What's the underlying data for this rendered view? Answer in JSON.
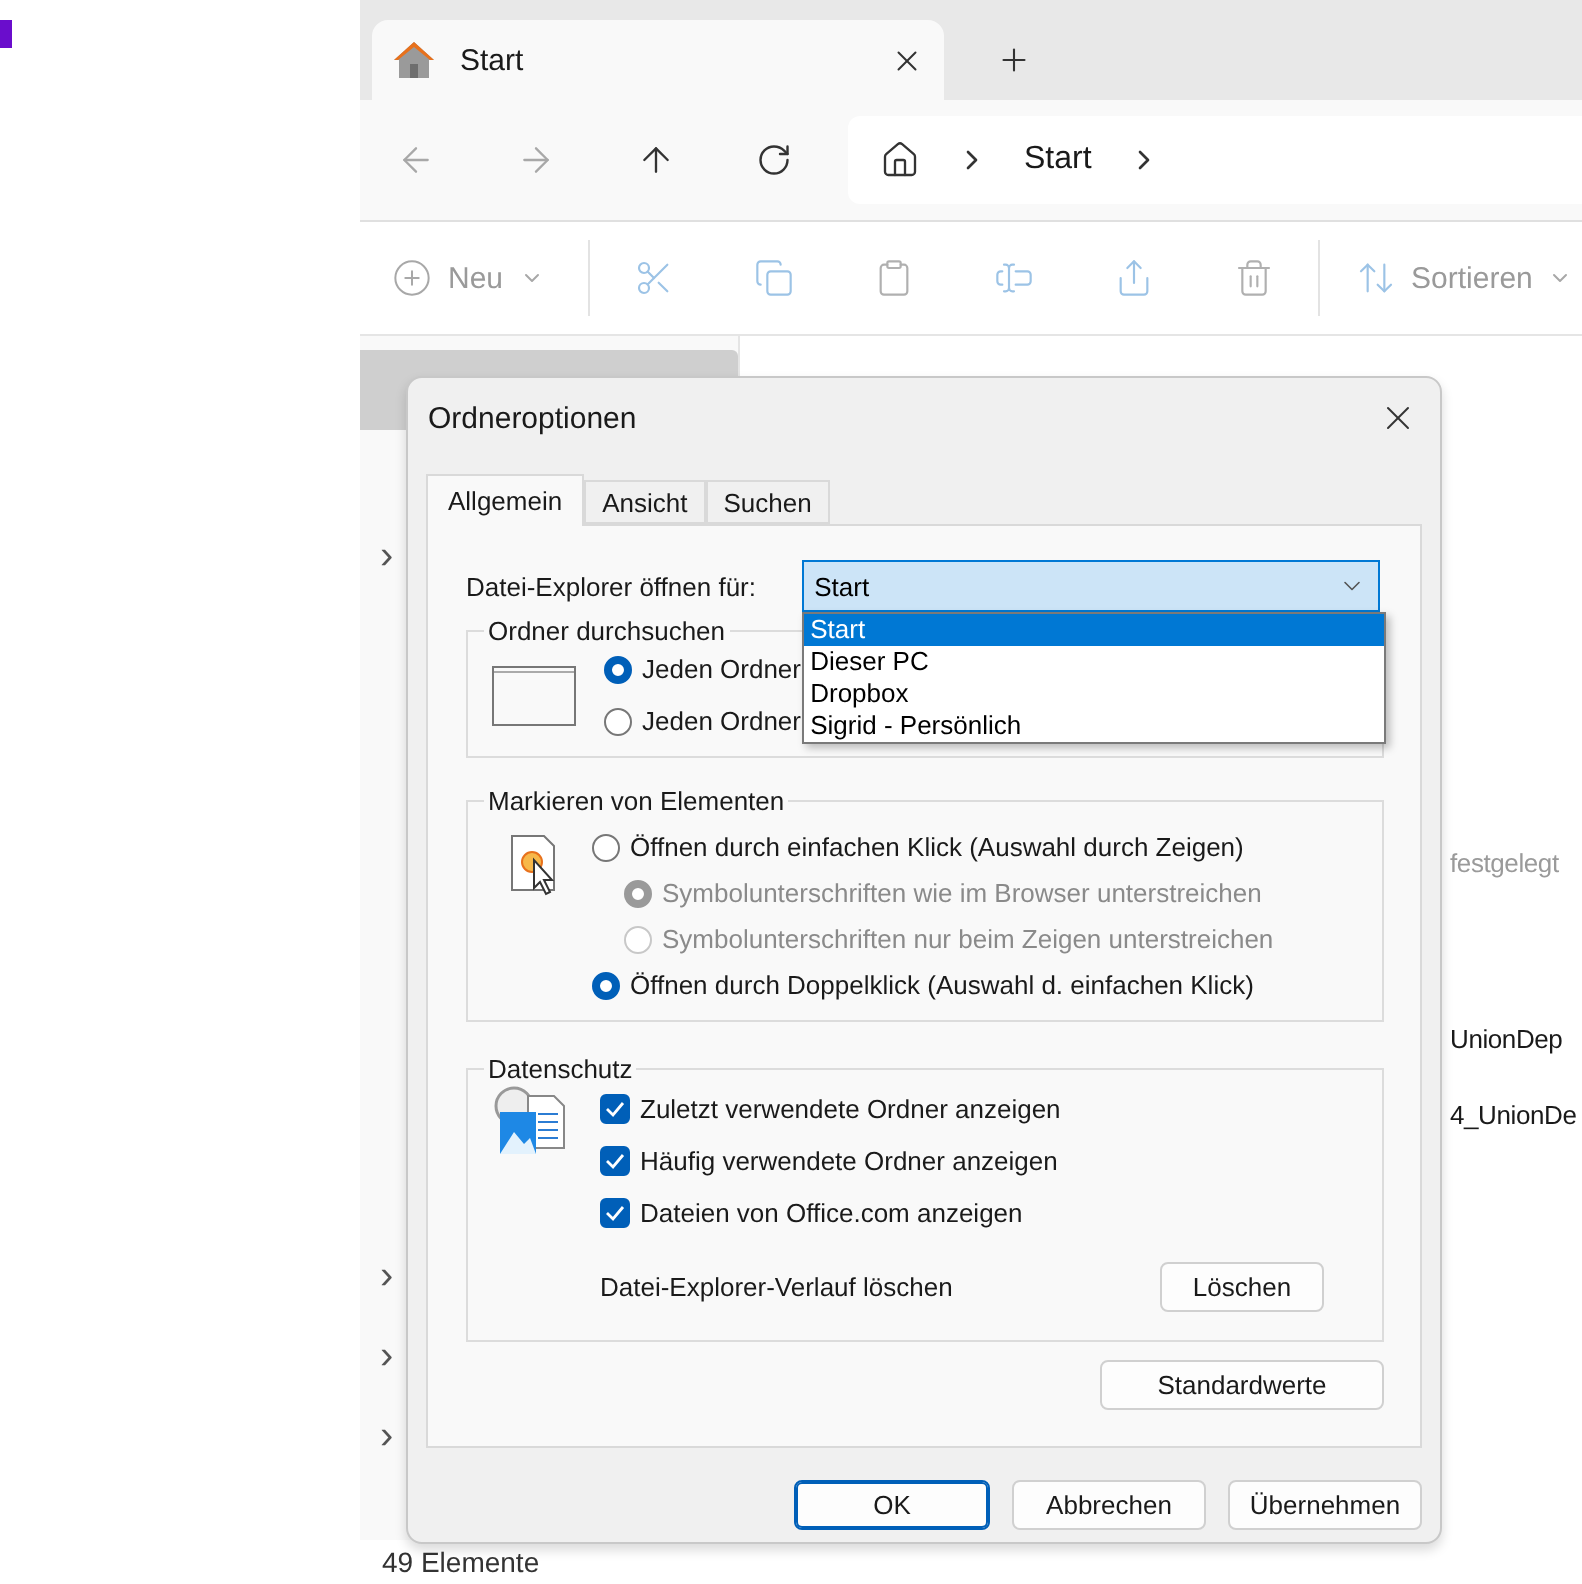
{
  "explorer": {
    "tab": {
      "title": "Start"
    },
    "breadcrumb": [
      "Start"
    ],
    "toolbar": {
      "new_label": "Neu",
      "sort_label": "Sortieren"
    },
    "sidebar": {
      "expanders": [
        "›",
        "›",
        "›",
        "›"
      ]
    },
    "content_rows": [
      {
        "text": "festgelegt",
        "dimmed": true
      },
      {
        "text": "UnionDep",
        "dimmed": false
      },
      {
        "text": "4_UnionDe",
        "dimmed": false
      }
    ],
    "status_bar": "49 Elemente"
  },
  "dialog": {
    "title": "Ordneroptionen",
    "tabs": [
      {
        "label": "Allgemein",
        "selected": true
      },
      {
        "label": "Ansicht",
        "selected": false
      },
      {
        "label": "Suchen",
        "selected": false
      }
    ],
    "open_for": {
      "label": "Datei-Explorer öffnen für:",
      "value": "Start",
      "expanded": true,
      "options": [
        {
          "label": "Start",
          "selected": true
        },
        {
          "label": "Dieser PC",
          "selected": false
        },
        {
          "label": "Dropbox",
          "selected": false
        },
        {
          "label": "Sigrid - Persönlich",
          "selected": false
        }
      ]
    },
    "browse_group": {
      "title": "Ordner durchsuchen",
      "options": [
        {
          "label": "Jeden Ordner",
          "selected": true
        },
        {
          "label": "Jeden Ordner",
          "selected": false
        }
      ]
    },
    "click_group": {
      "title": "Markieren von Elementen",
      "options": [
        {
          "label": "Öffnen durch einfachen Klick (Auswahl durch Zeigen)",
          "selected": false,
          "disabled": false,
          "children": [
            {
              "label": "Symbolunterschriften wie im Browser unterstreichen",
              "selected": true,
              "disabled": true
            },
            {
              "label": "Symbolunterschriften nur beim Zeigen unterstreichen",
              "selected": false,
              "disabled": true
            }
          ]
        },
        {
          "label": "Öffnen durch Doppelklick (Auswahl d. einfachen Klick)",
          "selected": true,
          "disabled": false
        }
      ]
    },
    "privacy_group": {
      "title": "Datenschutz",
      "checks": [
        {
          "label": "Zuletzt verwendete Ordner anzeigen",
          "checked": true
        },
        {
          "label": "Häufig verwendete Ordner anzeigen",
          "checked": true
        },
        {
          "label": "Dateien von Office.com anzeigen",
          "checked": true
        }
      ],
      "clear_label": "Datei-Explorer-Verlauf löschen",
      "clear_button": "Löschen"
    },
    "defaults_button": "Standardwerte",
    "buttons": [
      {
        "label": "OK",
        "primary": true
      },
      {
        "label": "Abbrechen",
        "primary": false
      },
      {
        "label": "Übernehmen",
        "primary": false
      }
    ]
  }
}
